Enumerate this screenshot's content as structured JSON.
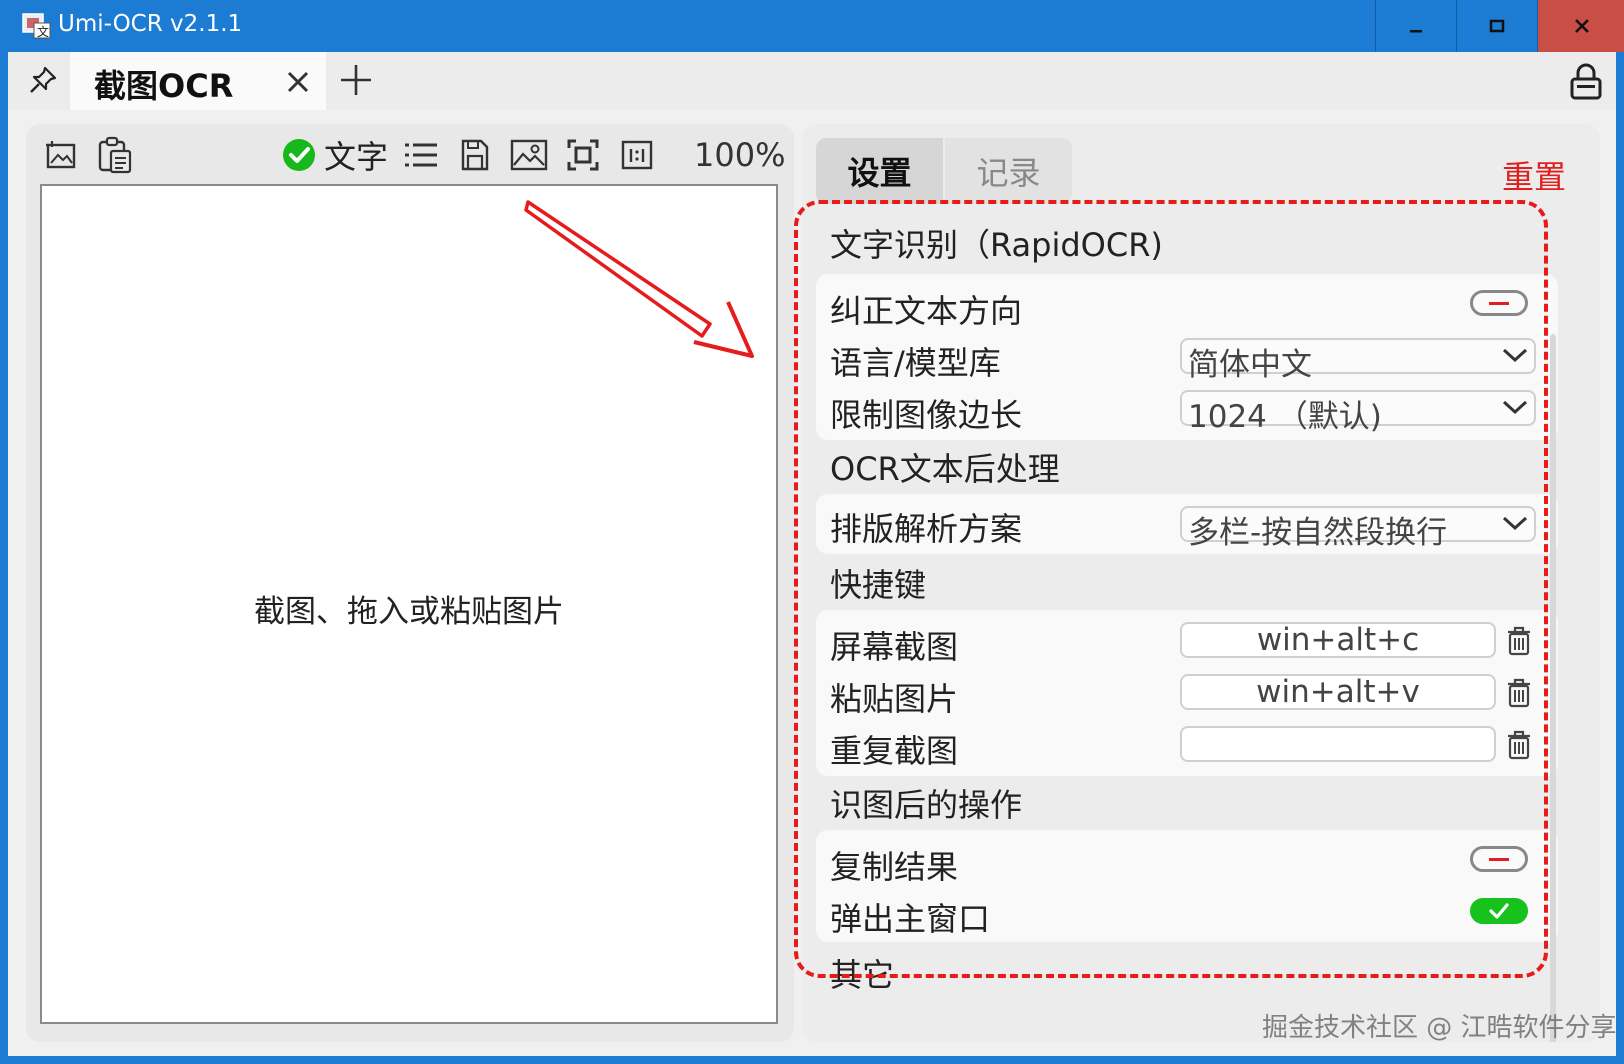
{
  "window": {
    "title": "Umi-OCR v2.1.1"
  },
  "tabs": {
    "active_label": "截图OCR"
  },
  "toolbar": {
    "text_toggle_label": "文字",
    "zoom": "100%",
    "icons": [
      "screenshot-icon",
      "paste-icon",
      "text-check-icon",
      "list-icon",
      "save-icon",
      "image-icon",
      "fit-screen-icon",
      "actual-size-icon"
    ]
  },
  "image_area": {
    "hint": "截图、拖入或粘贴图片"
  },
  "settings_panel": {
    "tab_settings": "设置",
    "tab_records": "记录",
    "reset_label": "重置",
    "groups": {
      "ocr": {
        "title": "文字识别（RapidOCR)",
        "correct_direction": {
          "label": "纠正文本方向",
          "enabled": false
        },
        "language": {
          "label": "语言/模型库",
          "value": "简体中文"
        },
        "limit_side": {
          "label": "限制图像边长",
          "value": "1024 （默认)"
        }
      },
      "post": {
        "title": "OCR文本后处理",
        "layout": {
          "label": "排版解析方案",
          "value": "多栏-按自然段换行"
        }
      },
      "hotkeys": {
        "title": "快捷键",
        "screenshot": {
          "label": "屏幕截图",
          "value": "win+alt+c"
        },
        "paste": {
          "label": "粘贴图片",
          "value": "win+alt+v"
        },
        "repeat": {
          "label": "重复截图",
          "value": ""
        }
      },
      "after": {
        "title": "识图后的操作",
        "copy_result": {
          "label": "复制结果",
          "enabled": false
        },
        "popup_main": {
          "label": "弹出主窗口",
          "enabled": true
        }
      },
      "other": {
        "title": "其它"
      }
    }
  },
  "watermark": "掘金技术社区 @ 江晧软件分享",
  "colors": {
    "titlebar": "#1c7bd3",
    "accent_red": "#e02020",
    "toggle_on": "#16c21b",
    "close_button": "#c94e46"
  }
}
